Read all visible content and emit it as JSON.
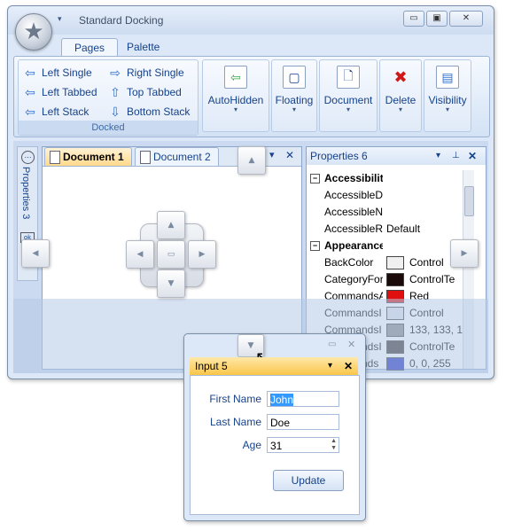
{
  "window": {
    "title": "Standard Docking",
    "qat_glyph": "▾",
    "controls": {
      "minimize": "▭",
      "restore": "▣",
      "close": "✕"
    }
  },
  "ribbon": {
    "tabs": [
      {
        "label": "Pages",
        "active": true
      },
      {
        "label": "Palette",
        "active": false
      }
    ],
    "docked_group": {
      "title": "Docked",
      "buttons": [
        {
          "label": "Left Single",
          "icon": "arrow-left-icon",
          "glyph": "⇦"
        },
        {
          "label": "Right Single",
          "icon": "arrow-right-icon",
          "glyph": "⇨"
        },
        {
          "label": "Left Tabbed",
          "icon": "arrow-left-icon",
          "glyph": "⇦"
        },
        {
          "label": "Top Tabbed",
          "icon": "arrow-up-icon",
          "glyph": "⇧"
        },
        {
          "label": "Left Stack",
          "icon": "arrow-left-icon",
          "glyph": "⇦"
        },
        {
          "label": "Bottom Stack",
          "icon": "arrow-down-icon",
          "glyph": "⇩"
        }
      ]
    },
    "big_buttons": [
      {
        "label": "AutoHidden",
        "icon": "autohidden-icon",
        "glyph": "⇦"
      },
      {
        "label": "Floating",
        "icon": "floating-window-icon",
        "glyph": "▢"
      },
      {
        "label": "Document",
        "icon": "document-icon",
        "glyph": "🗋"
      },
      {
        "label": "Delete",
        "icon": "delete-icon",
        "glyph": "✖"
      },
      {
        "label": "Visibility",
        "icon": "visibility-icon",
        "glyph": "▤"
      }
    ],
    "dropdown_glyph": "▾"
  },
  "autohide_strip": {
    "items": [
      "Properties 3",
      "4"
    ]
  },
  "documents": {
    "tabs": [
      {
        "label": "Document 1",
        "active": true
      },
      {
        "label": "Document 2",
        "active": false
      }
    ],
    "controls": {
      "dropdown": "▾",
      "close": "✕"
    }
  },
  "properties": {
    "title": "Properties 6",
    "controls": {
      "dropdown": "▾",
      "pin": "📌",
      "close": "✕"
    },
    "rows": [
      {
        "type": "category",
        "name": "Accessibility"
      },
      {
        "type": "prop",
        "name": "AccessibleDe",
        "value": ""
      },
      {
        "type": "prop",
        "name": "AccessibleN",
        "value": ""
      },
      {
        "type": "prop",
        "name": "AccessibleRo",
        "value": "Default"
      },
      {
        "type": "category",
        "name": "Appearance"
      },
      {
        "type": "prop",
        "name": "BackColor",
        "value": "Control",
        "swatch": "#f0f0f0"
      },
      {
        "type": "prop",
        "name": "CategoryFor",
        "value": "ControlTe",
        "swatch": "#1a0a0a"
      },
      {
        "type": "prop",
        "name": "CommandsA",
        "value": "Red",
        "swatch": "#e01010"
      },
      {
        "type": "prop",
        "name": "CommandsI",
        "value": "Control",
        "swatch": "#dfe3ea"
      },
      {
        "type": "prop",
        "name": "CommandsI",
        "value": "133, 133, 1",
        "swatch": "#858585"
      },
      {
        "type": "prop",
        "name": "CommandsI",
        "value": "ControlTe",
        "swatch": "#3b3434"
      },
      {
        "type": "prop",
        "name": "Commands",
        "value": "0, 0, 255",
        "swatch": "#2030c0"
      }
    ]
  },
  "float_window": {
    "title": "Input 5",
    "controls": {
      "dropdown": "▾",
      "close": "✕"
    },
    "fields": [
      {
        "label": "First Name",
        "value": "John"
      },
      {
        "label": "Last Name",
        "value": "Doe"
      },
      {
        "label": "Age",
        "value": "31"
      }
    ],
    "update_label": "Update"
  },
  "colors": {
    "accent": "#15428b",
    "active_tab": "#ffd98a",
    "frame": "#dce8f7"
  }
}
